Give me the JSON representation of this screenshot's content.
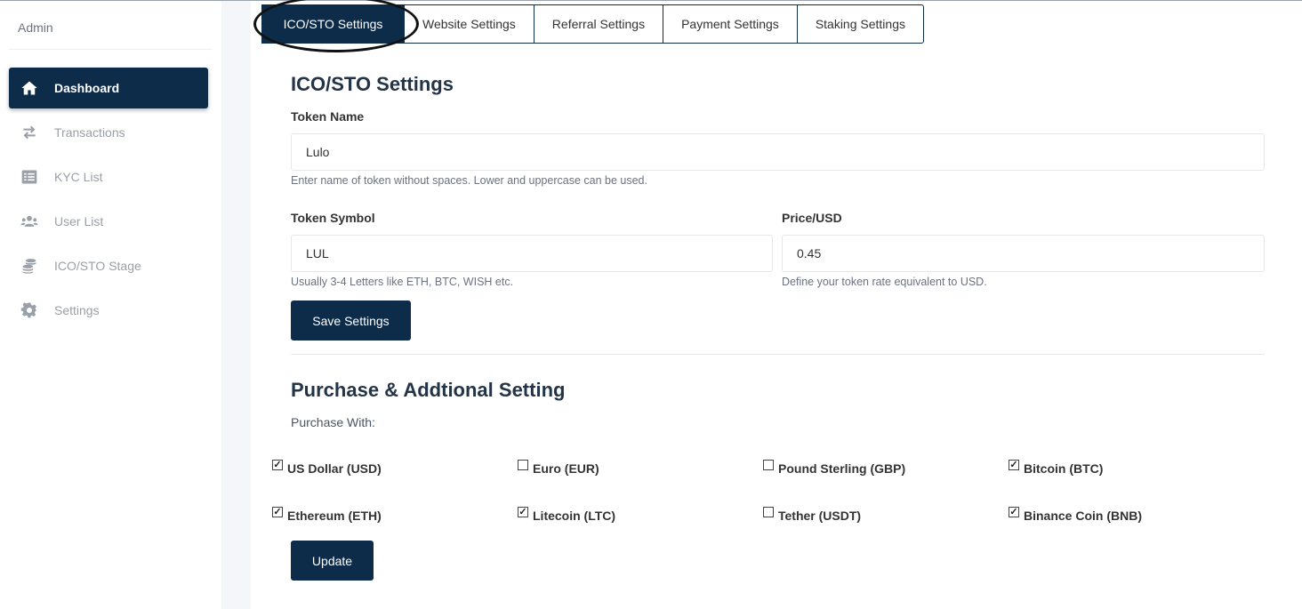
{
  "sidebar": {
    "brand": "Admin",
    "items": [
      {
        "label": "Dashboard",
        "icon": "home-icon",
        "active": true
      },
      {
        "label": "Transactions",
        "icon": "exchange-icon",
        "active": false
      },
      {
        "label": "KYC List",
        "icon": "list-icon",
        "active": false
      },
      {
        "label": "User List",
        "icon": "users-icon",
        "active": false
      },
      {
        "label": "ICO/STO Stage",
        "icon": "coins-icon",
        "active": false
      },
      {
        "label": "Settings",
        "icon": "gear-icon",
        "active": false
      }
    ]
  },
  "tabs": [
    {
      "label": "ICO/STO Settings",
      "active": true
    },
    {
      "label": "Website Settings",
      "active": false
    },
    {
      "label": "Referral Settings",
      "active": false
    },
    {
      "label": "Payment Settings",
      "active": false
    },
    {
      "label": "Staking Settings",
      "active": false
    }
  ],
  "token_section": {
    "title": "ICO/STO Settings",
    "token_name": {
      "label": "Token Name",
      "value": "Lulo",
      "help": "Enter name of token without spaces. Lower and uppercase can be used."
    },
    "token_symbol": {
      "label": "Token Symbol",
      "value": "LUL",
      "help": "Usually 3-4 Letters like ETH, BTC, WISH etc."
    },
    "price": {
      "label": "Price/USD",
      "value": "0.45",
      "help": "Define your token rate equivalent to USD."
    },
    "save_label": "Save Settings"
  },
  "purchase_section": {
    "title": "Purchase & Addtional Setting",
    "purchase_with_label": "Purchase With:",
    "options": [
      {
        "label": "US Dollar (USD)",
        "checked": true
      },
      {
        "label": "Euro (EUR)",
        "checked": false
      },
      {
        "label": "Pound Sterling (GBP)",
        "checked": false
      },
      {
        "label": "Bitcoin (BTC)",
        "checked": true
      },
      {
        "label": "Ethereum (ETH)",
        "checked": true
      },
      {
        "label": "Litecoin (LTC)",
        "checked": true
      },
      {
        "label": "Tether (USDT)",
        "checked": false
      },
      {
        "label": "Binance Coin (BNB)",
        "checked": true
      }
    ],
    "update_label": "Update"
  },
  "colors": {
    "primary": "#0d2c4a",
    "sidebar_bg": "#ffffff",
    "page_bg": "#f4f6fa"
  }
}
